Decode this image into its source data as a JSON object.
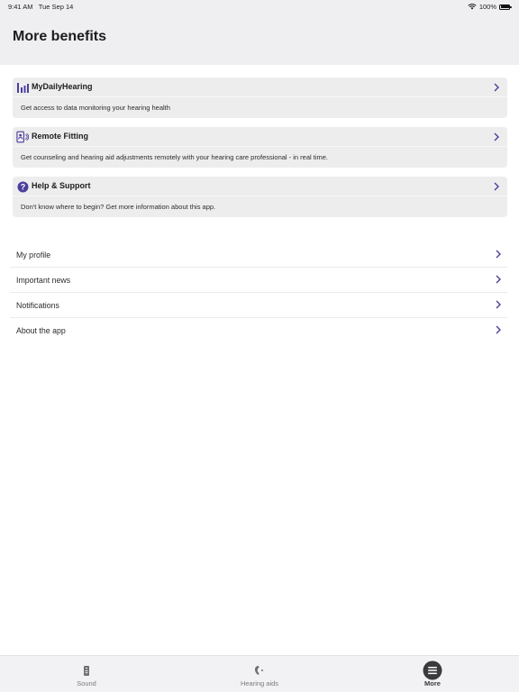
{
  "status_bar": {
    "time": "9:41 AM",
    "date": "Tue Sep 14",
    "battery": "100%",
    "wifi_icon": "wifi-icon",
    "battery_icon": "battery-full-icon"
  },
  "header": {
    "title": "More benefits"
  },
  "cards": [
    {
      "icon": "bar-chart-icon",
      "title": "MyDailyHearing",
      "description": "Get access to data monitoring your hearing health"
    },
    {
      "icon": "remote-device-icon",
      "title": "Remote Fitting",
      "description": "Get counseling and hearing aid adjustments remotely with your hearing care professional - in real time."
    },
    {
      "icon": "question-circle-icon",
      "title": "Help & Support",
      "description": "Don't know where to begin? Get more information about this app."
    }
  ],
  "menu": [
    {
      "label": "My profile"
    },
    {
      "label": "Important news"
    },
    {
      "label": "Notifications"
    },
    {
      "label": "About the app"
    }
  ],
  "tabbar": {
    "tabs": [
      {
        "label": "Sound",
        "icon": "remote-control-icon",
        "active": false
      },
      {
        "label": "Hearing aids",
        "icon": "hearing-aid-icon",
        "active": false
      },
      {
        "label": "More",
        "icon": "menu-circle-icon",
        "active": true
      }
    ]
  },
  "colors": {
    "accent": "#4b3f9c",
    "header_bg": "#efeff1",
    "card_bg": "#ededee"
  }
}
